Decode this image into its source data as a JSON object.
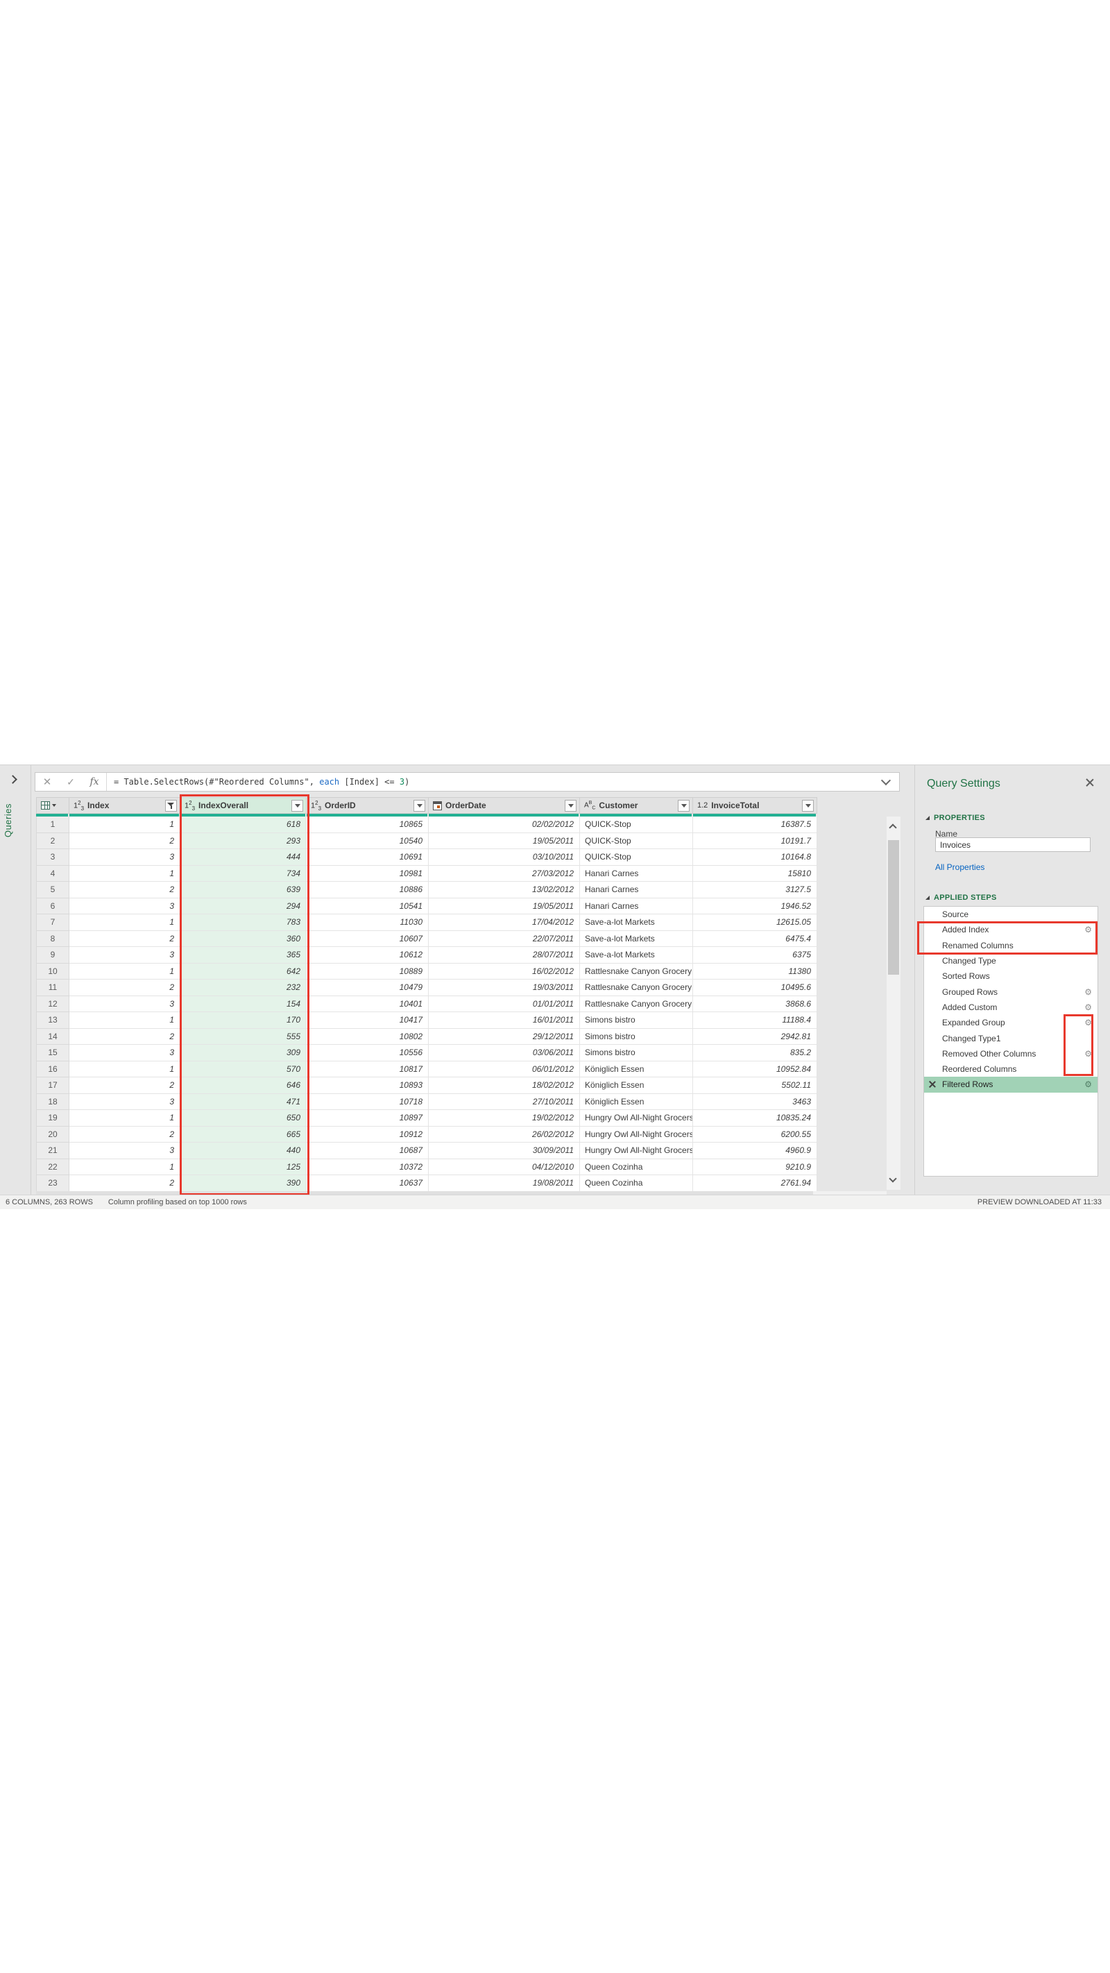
{
  "app": "Power Query Editor",
  "queries_tab_label": "Queries",
  "formula": {
    "tokens": [
      {
        "text": "= Table.SelectRows(#\"Reordered Columns\", ",
        "kind": "default"
      },
      {
        "text": "each",
        "kind": "keyword"
      },
      {
        "text": " [Index] <= ",
        "kind": "default"
      },
      {
        "text": "3",
        "kind": "number"
      },
      {
        "text": ")",
        "kind": "default"
      }
    ]
  },
  "table": {
    "columns": [
      {
        "label": "Index",
        "type_icon": "123",
        "control": "filter",
        "highlighted": false,
        "align": "num"
      },
      {
        "label": "IndexOverall",
        "type_icon": "123",
        "control": "dropdown",
        "highlighted": true,
        "align": "num"
      },
      {
        "label": "OrderID",
        "type_icon": "123",
        "control": "dropdown",
        "highlighted": false,
        "align": "num"
      },
      {
        "label": "OrderDate",
        "type_icon": "calendar",
        "control": "dropdown",
        "highlighted": false,
        "align": "num"
      },
      {
        "label": "Customer",
        "type_icon": "abc",
        "control": "dropdown",
        "highlighted": false,
        "align": "txt"
      },
      {
        "label": "InvoiceTotal",
        "type_icon": "1.2",
        "control": "dropdown",
        "highlighted": false,
        "align": "num"
      }
    ],
    "rows": [
      {
        "n": 1,
        "cells": [
          "1",
          "618",
          "10865",
          "02/02/2012",
          "QUICK-Stop",
          "16387.5"
        ]
      },
      {
        "n": 2,
        "cells": [
          "2",
          "293",
          "10540",
          "19/05/2011",
          "QUICK-Stop",
          "10191.7"
        ]
      },
      {
        "n": 3,
        "cells": [
          "3",
          "444",
          "10691",
          "03/10/2011",
          "QUICK-Stop",
          "10164.8"
        ]
      },
      {
        "n": 4,
        "cells": [
          "1",
          "734",
          "10981",
          "27/03/2012",
          "Hanari Carnes",
          "15810"
        ]
      },
      {
        "n": 5,
        "cells": [
          "2",
          "639",
          "10886",
          "13/02/2012",
          "Hanari Carnes",
          "3127.5"
        ]
      },
      {
        "n": 6,
        "cells": [
          "3",
          "294",
          "10541",
          "19/05/2011",
          "Hanari Carnes",
          "1946.52"
        ]
      },
      {
        "n": 7,
        "cells": [
          "1",
          "783",
          "11030",
          "17/04/2012",
          "Save-a-lot Markets",
          "12615.05"
        ]
      },
      {
        "n": 8,
        "cells": [
          "2",
          "360",
          "10607",
          "22/07/2011",
          "Save-a-lot Markets",
          "6475.4"
        ]
      },
      {
        "n": 9,
        "cells": [
          "3",
          "365",
          "10612",
          "28/07/2011",
          "Save-a-lot Markets",
          "6375"
        ]
      },
      {
        "n": 10,
        "cells": [
          "1",
          "642",
          "10889",
          "16/02/2012",
          "Rattlesnake Canyon Grocery",
          "11380"
        ]
      },
      {
        "n": 11,
        "cells": [
          "2",
          "232",
          "10479",
          "19/03/2011",
          "Rattlesnake Canyon Grocery",
          "10495.6"
        ]
      },
      {
        "n": 12,
        "cells": [
          "3",
          "154",
          "10401",
          "01/01/2011",
          "Rattlesnake Canyon Grocery",
          "3868.6"
        ]
      },
      {
        "n": 13,
        "cells": [
          "1",
          "170",
          "10417",
          "16/01/2011",
          "Simons bistro",
          "11188.4"
        ]
      },
      {
        "n": 14,
        "cells": [
          "2",
          "555",
          "10802",
          "29/12/2011",
          "Simons bistro",
          "2942.81"
        ]
      },
      {
        "n": 15,
        "cells": [
          "3",
          "309",
          "10556",
          "03/06/2011",
          "Simons bistro",
          "835.2"
        ]
      },
      {
        "n": 16,
        "cells": [
          "1",
          "570",
          "10817",
          "06/01/2012",
          "Königlich Essen",
          "10952.84"
        ]
      },
      {
        "n": 17,
        "cells": [
          "2",
          "646",
          "10893",
          "18/02/2012",
          "Königlich Essen",
          "5502.11"
        ]
      },
      {
        "n": 18,
        "cells": [
          "3",
          "471",
          "10718",
          "27/10/2011",
          "Königlich Essen",
          "3463"
        ]
      },
      {
        "n": 19,
        "cells": [
          "1",
          "650",
          "10897",
          "19/02/2012",
          "Hungry Owl All-Night Grocers",
          "10835.24"
        ]
      },
      {
        "n": 20,
        "cells": [
          "2",
          "665",
          "10912",
          "26/02/2012",
          "Hungry Owl All-Night Grocers",
          "6200.55"
        ]
      },
      {
        "n": 21,
        "cells": [
          "3",
          "440",
          "10687",
          "30/09/2011",
          "Hungry Owl All-Night Grocers",
          "4960.9"
        ]
      },
      {
        "n": 22,
        "cells": [
          "1",
          "125",
          "10372",
          "04/12/2010",
          "Queen Cozinha",
          "9210.9"
        ]
      },
      {
        "n": 23,
        "cells": [
          "2",
          "390",
          "10637",
          "19/08/2011",
          "Queen Cozinha",
          "2761.94"
        ]
      }
    ]
  },
  "panel": {
    "title": "Query Settings",
    "properties_header": "PROPERTIES",
    "name_label": "Name",
    "name_value": "Invoices",
    "all_properties_link": "All Properties",
    "steps_header": "APPLIED STEPS",
    "steps": [
      {
        "label": "Source",
        "gear": false,
        "selected": false
      },
      {
        "label": "Added Index",
        "gear": true,
        "selected": false
      },
      {
        "label": "Renamed Columns",
        "gear": false,
        "selected": false
      },
      {
        "label": "Changed Type",
        "gear": false,
        "selected": false
      },
      {
        "label": "Sorted Rows",
        "gear": false,
        "selected": false
      },
      {
        "label": "Grouped Rows",
        "gear": true,
        "selected": false
      },
      {
        "label": "Added Custom",
        "gear": true,
        "selected": false
      },
      {
        "label": "Expanded Group",
        "gear": true,
        "selected": false
      },
      {
        "label": "Changed Type1",
        "gear": false,
        "selected": false
      },
      {
        "label": "Removed Other Columns",
        "gear": true,
        "selected": false
      },
      {
        "label": "Reordered Columns",
        "gear": false,
        "selected": false
      },
      {
        "label": "Filtered Rows",
        "gear": true,
        "selected": true
      }
    ]
  },
  "status_bar": {
    "left_primary": "6 COLUMNS, 263 ROWS",
    "left_secondary": "Column profiling based on top 1000 rows",
    "right": "PREVIEW DOWNLOADED AT 11:33"
  },
  "colors": {
    "accent_green": "#217346",
    "quality_bar_teal": "#23b093",
    "annotation_red": "#e8392d",
    "selected_step_green": "#a1d2b6",
    "link_blue": "#0563c1",
    "highlight_cell_green": "#e4f3e9"
  }
}
